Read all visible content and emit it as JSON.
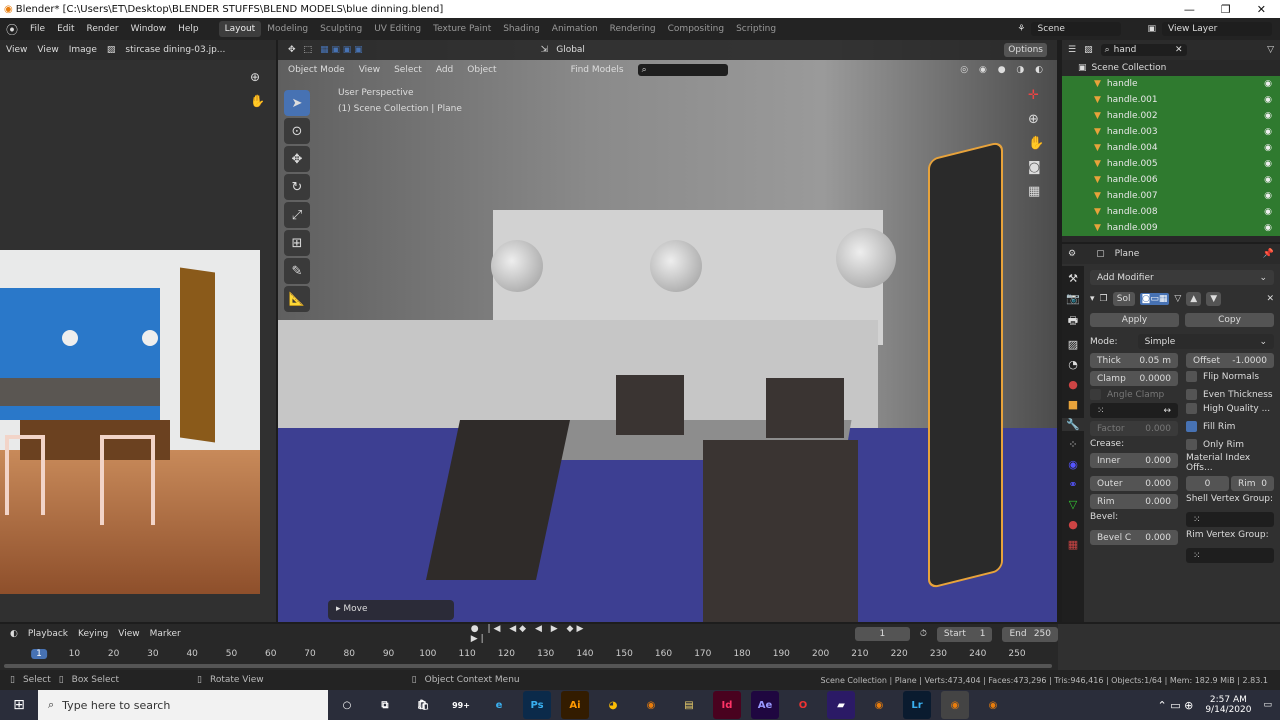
{
  "window": {
    "title": "Blender* [C:\\Users\\ET\\Desktop\\BLENDER STUFFS\\BLEND MODELS\\blue dinning.blend]",
    "minimize": "—",
    "maximize": "❐",
    "close": "✕"
  },
  "menu": [
    "File",
    "Edit",
    "Render",
    "Window",
    "Help"
  ],
  "workspaces": [
    "Layout",
    "Modeling",
    "Sculpting",
    "UV Editing",
    "Texture Paint",
    "Shading",
    "Animation",
    "Rendering",
    "Compositing",
    "Scripting"
  ],
  "scene": {
    "name": "Scene",
    "view_layer": "View Layer"
  },
  "image_editor": {
    "menus": [
      "View",
      "View",
      "Image"
    ],
    "image_name": "stircase dining-03.jp..."
  },
  "viewport": {
    "menus": [
      "Object Mode",
      "View",
      "Select",
      "Add",
      "Object"
    ],
    "orientation": "Global",
    "find_models": "Find Models",
    "options": "Options",
    "perspective": "User Perspective",
    "collection": "(1) Scene Collection | Plane",
    "last_op": "Move"
  },
  "outliner": {
    "search": "hand",
    "root": "Scene Collection",
    "items": [
      "handle",
      "handle.001",
      "handle.002",
      "handle.003",
      "handle.004",
      "handle.005",
      "handle.006",
      "handle.007",
      "handle.008",
      "handle.009"
    ]
  },
  "properties": {
    "object": "Plane",
    "add_modifier": "Add Modifier",
    "modifier_name": "Sol",
    "apply": "Apply",
    "copy": "Copy",
    "mode_label": "Mode:",
    "mode": "Simple",
    "thick_label": "Thick",
    "thick": "0.05 m",
    "offset_label": "Offset",
    "offset": "-1.0000",
    "clamp_label": "Clamp",
    "clamp": "0.0000",
    "angle_clamp": "Angle Clamp",
    "flip_normals": "Flip Normals",
    "even_thickness": "Even Thickness",
    "high_quality": "High Quality ...",
    "fill_rim": "Fill Rim",
    "only_rim": "Only Rim",
    "factor_label": "Factor",
    "factor": "0.000",
    "crease": "Crease:",
    "inner_label": "Inner",
    "inner": "0.000",
    "outer_label": "Outer",
    "outer": "0.000",
    "rim_label": "Rim",
    "rim": "0.000",
    "bevel": "Bevel:",
    "bevel_label": "Bevel C",
    "bevel_val": "0.000",
    "mat_index": "Material Index Offs...",
    "mat_index_val": "0",
    "mat_rim_label": "Rim",
    "mat_rim": "0",
    "shell_vg": "Shell Vertex Group:",
    "rim_vg": "Rim Vertex Group:"
  },
  "timeline": {
    "menus": [
      "Playback",
      "Keying",
      "View",
      "Marker"
    ],
    "current": "1",
    "start_label": "Start",
    "start": "1",
    "end_label": "End",
    "end": "250",
    "ticks": [
      "1",
      "10",
      "20",
      "30",
      "40",
      "50",
      "60",
      "70",
      "80",
      "90",
      "100",
      "110",
      "120",
      "130",
      "140",
      "150",
      "160",
      "170",
      "180",
      "190",
      "200",
      "210",
      "220",
      "230",
      "240",
      "250"
    ]
  },
  "statusbar": {
    "select": "Select",
    "box_select": "Box Select",
    "rotate": "Rotate View",
    "context": "Object Context Menu",
    "stats": "Scene Collection | Plane | Verts:473,404 | Faces:473,296 | Tris:946,416 | Objects:1/64 | Mem: 182.9 MiB | 2.83.1"
  },
  "taskbar": {
    "search": "Type here to search",
    "time": "2:57 AM",
    "date": "9/14/2020",
    "mail_badge": "99+",
    "apps": [
      "Ps",
      "Ai",
      "Id",
      "Ae",
      "Lr"
    ]
  },
  "colors": {
    "accent": "#4772b3",
    "outliner_green": "#2f7a2f",
    "floor": "#3d3f92",
    "selection": "#e8a33b"
  }
}
